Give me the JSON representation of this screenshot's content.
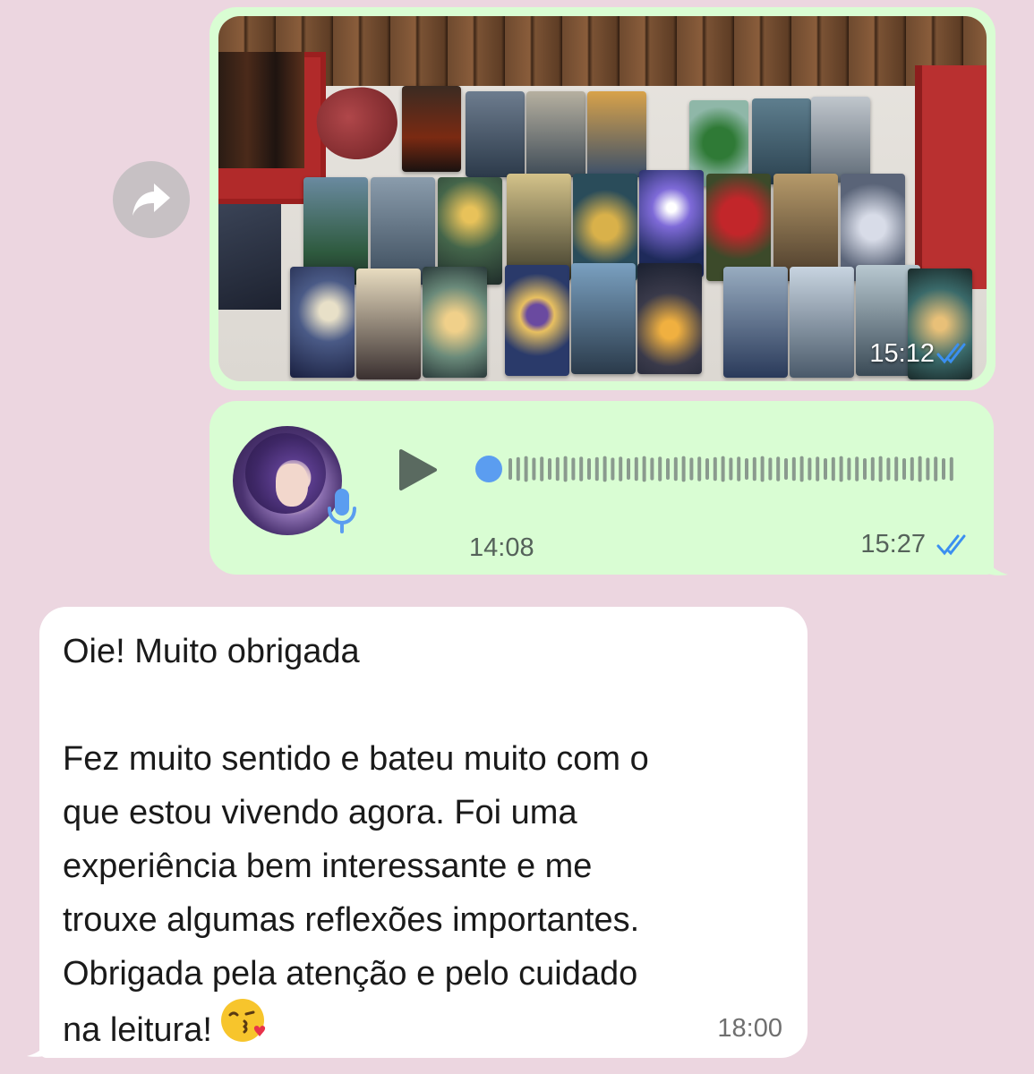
{
  "messages": {
    "photo": {
      "time": "15:12",
      "status": "read"
    },
    "voice": {
      "duration": "14:08",
      "time": "15:27",
      "status": "read",
      "progress": 0
    },
    "text": {
      "lines": [
        "Oie! Muito obrigada",
        "",
        "Fez muito sentido e bateu muito com o",
        "que estou vivendo agora. Foi uma",
        "experiência bem interessante e me",
        "trouxe algumas reflexões importantes.",
        "Obrigada pela atenção e pelo cuidado",
        "na leitura!"
      ],
      "time": "18:00"
    }
  },
  "icons": {
    "forward": "forward-arrow-icon",
    "play": "play-icon",
    "mic": "microphone-icon",
    "read": "double-check-icon",
    "emoji": "face-blowing-kiss-emoji"
  },
  "colors": {
    "chat_background": "#ecd6e0",
    "outgoing_bubble": "#d9fdd3",
    "incoming_bubble": "#ffffff",
    "read_ticks": "#3b8ff0",
    "voice_accent": "#5b9df0",
    "waveform": "#8a9a8e"
  }
}
